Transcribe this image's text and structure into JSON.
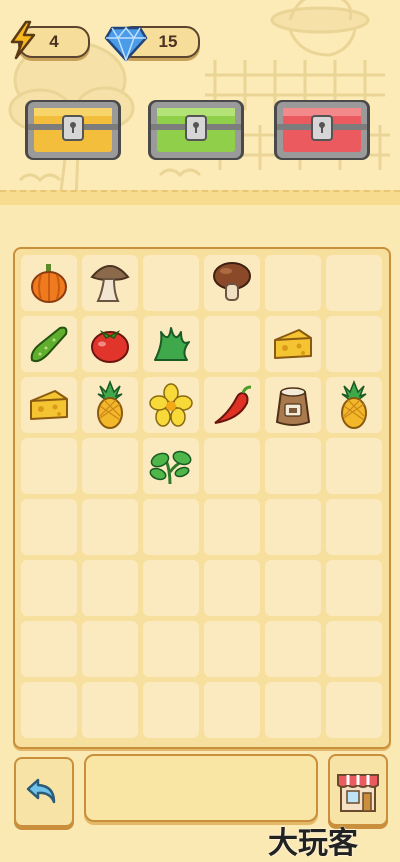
{
  "resources": {
    "energy": {
      "value": "4",
      "icon": "lightning-icon",
      "color": "#f6b21c"
    },
    "gems": {
      "value": "15",
      "icon": "diamond-icon",
      "color": "#4a9be8"
    }
  },
  "chests": [
    {
      "name": "yellow-chest",
      "color": "#f3be3c"
    },
    {
      "name": "green-chest",
      "color": "#8fcf49"
    },
    {
      "name": "red-chest",
      "color": "#ea5a5e"
    }
  ],
  "board": {
    "columns": 6,
    "rows": 8,
    "items": [
      {
        "row": 0,
        "col": 0,
        "item": "pumpkin"
      },
      {
        "row": 0,
        "col": 1,
        "item": "brown-mushroom-pale"
      },
      {
        "row": 0,
        "col": 3,
        "item": "brown-mushroom"
      },
      {
        "row": 1,
        "col": 0,
        "item": "cucumber"
      },
      {
        "row": 1,
        "col": 1,
        "item": "tomato"
      },
      {
        "row": 1,
        "col": 2,
        "item": "grass-sprout"
      },
      {
        "row": 1,
        "col": 4,
        "item": "cheese"
      },
      {
        "row": 2,
        "col": 0,
        "item": "cheese"
      },
      {
        "row": 2,
        "col": 1,
        "item": "pineapple"
      },
      {
        "row": 2,
        "col": 2,
        "item": "yellow-flower"
      },
      {
        "row": 2,
        "col": 3,
        "item": "chili-pepper"
      },
      {
        "row": 2,
        "col": 4,
        "item": "flour-sack"
      },
      {
        "row": 2,
        "col": 5,
        "item": "pineapple"
      },
      {
        "row": 3,
        "col": 2,
        "item": "seedling"
      }
    ]
  },
  "bottom_bar": {
    "back_icon": "undo-arrow-icon",
    "info_text": "",
    "shop_icon": "shop-icon"
  },
  "watermark": {
    "text": "大玩客"
  }
}
